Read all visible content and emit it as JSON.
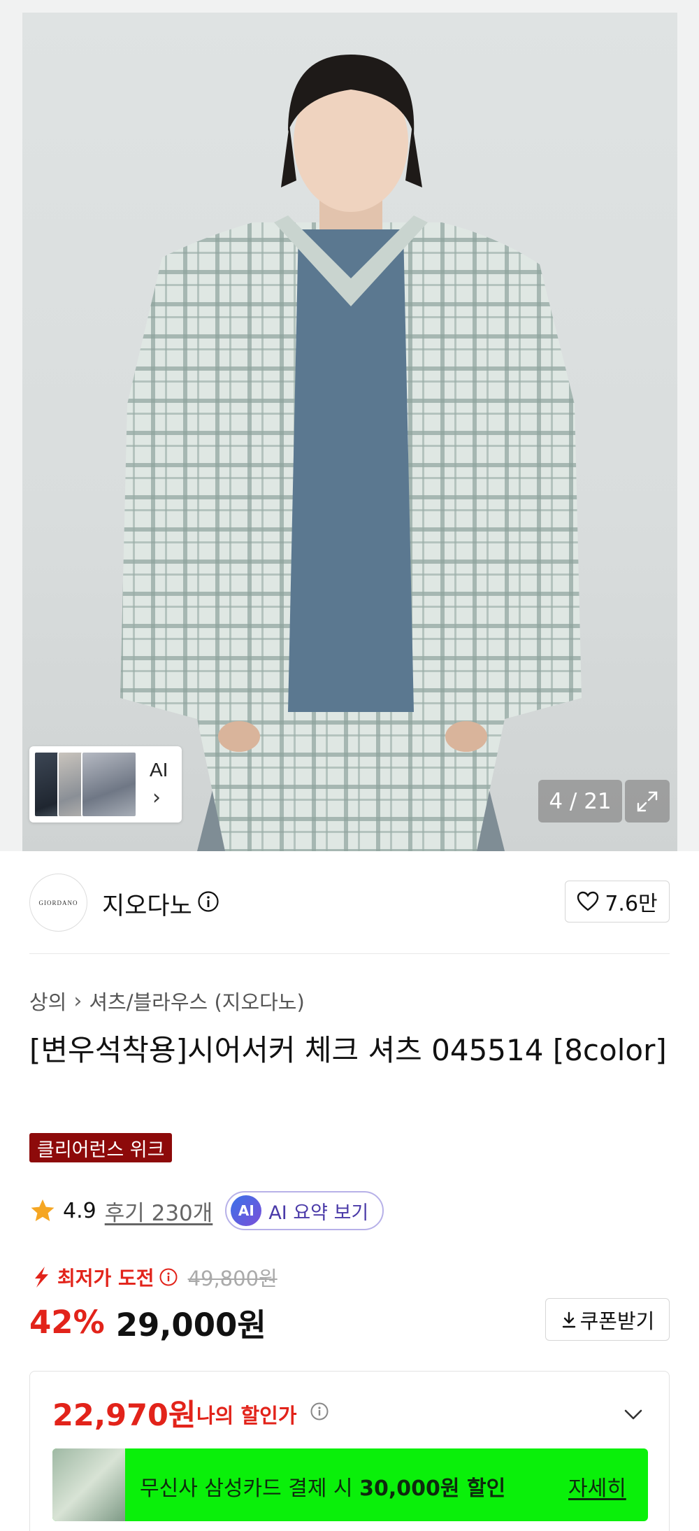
{
  "gallery": {
    "ai_label": "AI",
    "counter": "4 / 21"
  },
  "brand": {
    "logo_text": "GIORDANO",
    "name": "지오다노",
    "likes": "7.6만"
  },
  "breadcrumb": {
    "category": "상의",
    "subcategory": "셔츠/블라우스 (지오다노)"
  },
  "product": {
    "title": "[변우석착용]시어서커 체크 셔츠 045514 [8color]",
    "badge": "클리어런스 위크",
    "rating": "4.9",
    "reviews": "후기 230개",
    "ai_badge": "AI",
    "ai_summary": "AI 요약 보기"
  },
  "pricing": {
    "lowest_label": "최저가 도전",
    "original_price": "49,800원",
    "discount_rate": "42%",
    "price": "29,000원",
    "coupon_button": "쿠폰받기"
  },
  "my_discount": {
    "price": "22,970원",
    "label": "나의 할인가",
    "promo_prefix": "무신사 삼성카드 결제 시 ",
    "promo_amount": "30,000원 할인",
    "promo_more": "자세히"
  },
  "colors": {
    "accent_red": "#e2231a",
    "badge_bg": "#8d0a0a",
    "promo_green": "#0af00a"
  }
}
